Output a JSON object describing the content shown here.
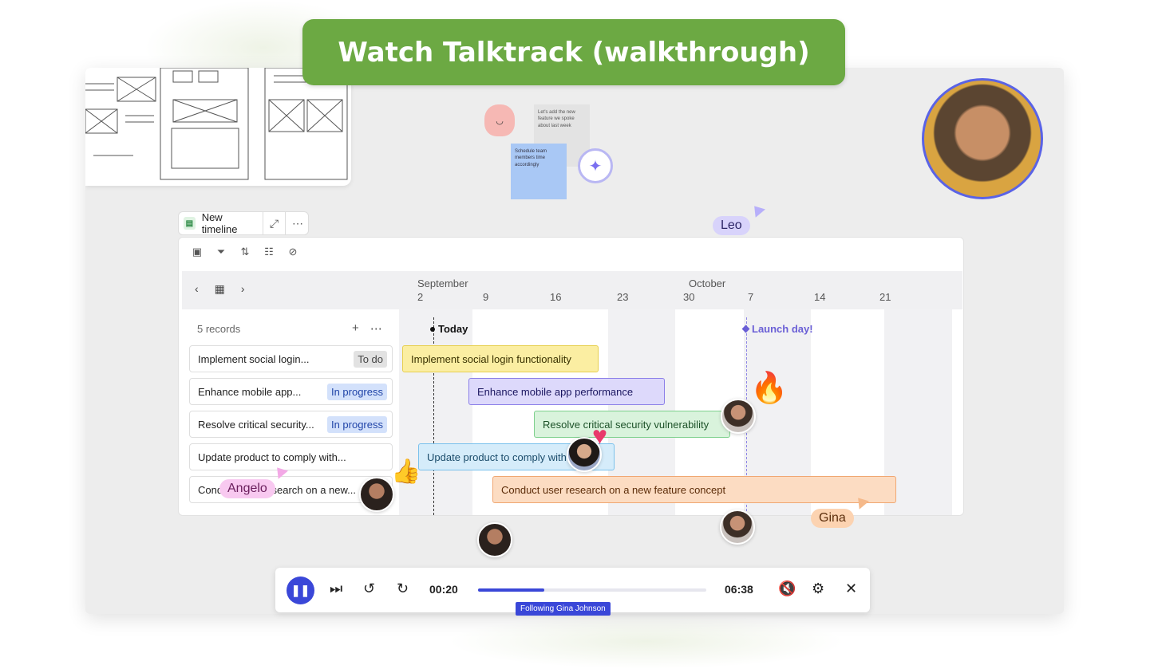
{
  "banner": {
    "title": "Watch Talktrack (walkthrough)"
  },
  "canvas": {
    "notes": {
      "gray": "Let's add the new feature we spoke about last week",
      "blue": "Schedule team members time accordingly"
    }
  },
  "timeline_widget": {
    "chip_label": "New timeline",
    "toolbar_icons": [
      "card-icon",
      "filter-icon",
      "sort-icon",
      "group-icon",
      "hide-icon"
    ],
    "months": [
      "September",
      "October"
    ],
    "days": [
      "2",
      "9",
      "16",
      "23",
      "30",
      "7",
      "14",
      "21"
    ],
    "records_label": "5 records",
    "today_label": "Today",
    "launch_label": "Launch day!",
    "records": [
      {
        "name": "Implement social login...",
        "status": "To do",
        "bar": "Implement social login functionality"
      },
      {
        "name": "Enhance mobile app...",
        "status": "In progress",
        "bar": "Enhance mobile app performance"
      },
      {
        "name": "Resolve critical security...",
        "status": "In progress",
        "bar": "Resolve critical security vulnerability"
      },
      {
        "name": "Update product to comply with...",
        "status": "",
        "bar": "Update product to comply with ..."
      },
      {
        "name": "Conduct user research on a new...",
        "status": "",
        "bar": "Conduct user research on a new feature concept"
      }
    ]
  },
  "collaborators": {
    "leo": "Leo",
    "angelo": "Angelo",
    "gina": "Gina"
  },
  "player": {
    "current_time": "00:20",
    "total_time": "06:38",
    "progress": 0.29,
    "following": "Following Gina Johnson"
  },
  "colors": {
    "accent": "#3a47d8",
    "banner": "#6ca943"
  }
}
